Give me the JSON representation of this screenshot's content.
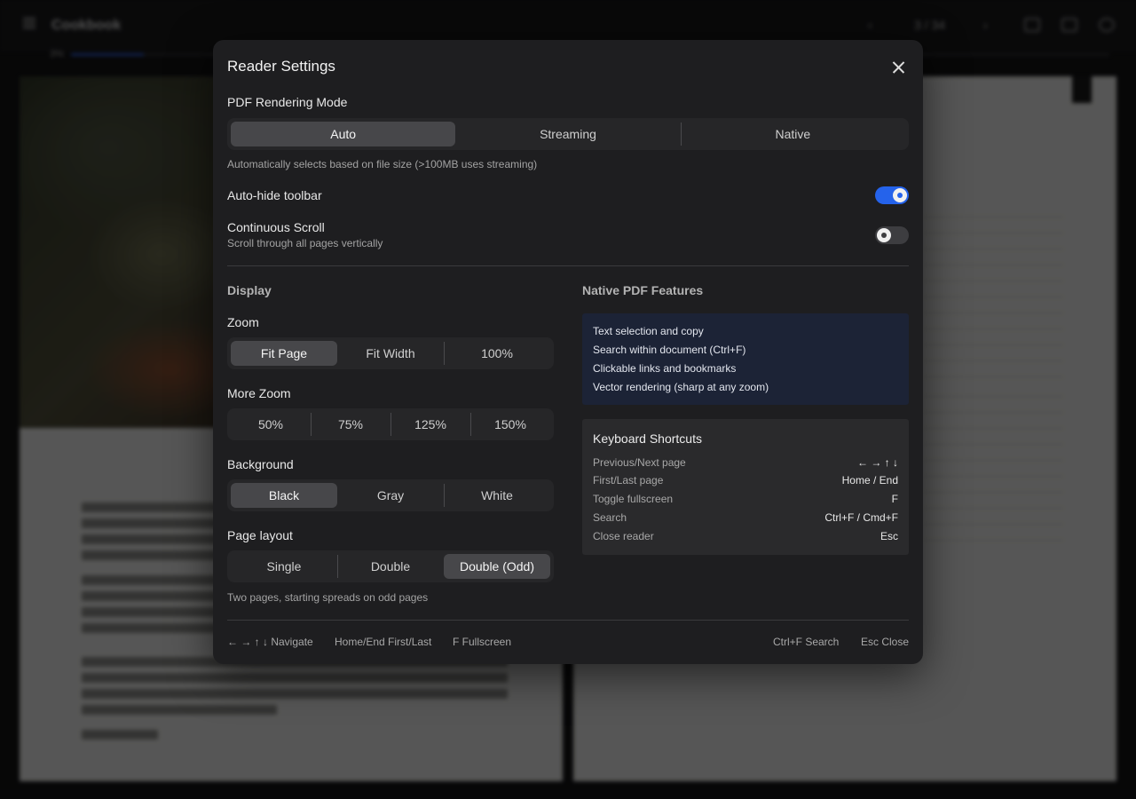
{
  "background": {
    "title": "Cookbook",
    "page_indicator": "3 / 34",
    "progress_label": "3%",
    "progress_fraction": 0.07
  },
  "modal": {
    "title": "Reader Settings",
    "rendering": {
      "label": "PDF Rendering Mode",
      "options": [
        "Auto",
        "Streaming",
        "Native"
      ],
      "selected": "Auto",
      "description": "Automatically selects based on file size (>100MB uses streaming)"
    },
    "auto_hide": {
      "label": "Auto-hide toolbar",
      "enabled": true
    },
    "continuous_scroll": {
      "label": "Continuous Scroll",
      "description": "Scroll through all pages vertically",
      "enabled": false
    },
    "display": {
      "title": "Display",
      "zoom": {
        "label": "Zoom",
        "options": [
          "Fit Page",
          "Fit Width",
          "100%"
        ],
        "selected": "Fit Page"
      },
      "more_zoom": {
        "label": "More Zoom",
        "options": [
          "50%",
          "75%",
          "125%",
          "150%"
        ]
      },
      "background": {
        "label": "Background",
        "options": [
          "Black",
          "Gray",
          "White"
        ],
        "selected": "Black"
      },
      "page_layout": {
        "label": "Page layout",
        "options": [
          "Single",
          "Double",
          "Double (Odd)"
        ],
        "selected": "Double (Odd)",
        "description": "Two pages, starting spreads on odd pages"
      }
    },
    "native_features": {
      "title": "Native PDF Features",
      "items": [
        "Text selection and copy",
        "Search within document (Ctrl+F)",
        "Clickable links and bookmarks",
        "Vector rendering (sharp at any zoom)"
      ]
    },
    "shortcuts": {
      "title": "Keyboard Shortcuts",
      "items": [
        {
          "action": "Previous/Next page",
          "keys": "← → ↑ ↓"
        },
        {
          "action": "First/Last page",
          "keys": "Home / End"
        },
        {
          "action": "Toggle fullscreen",
          "keys": "F"
        },
        {
          "action": "Search",
          "keys": "Ctrl+F / Cmd+F"
        },
        {
          "action": "Close reader",
          "keys": "Esc"
        }
      ]
    },
    "footer": {
      "navigate": "← → ↑ ↓ Navigate",
      "first_last": "Home/End First/Last",
      "fullscreen": "F Fullscreen",
      "search": "Ctrl+F Search",
      "close": "Esc Close"
    }
  }
}
